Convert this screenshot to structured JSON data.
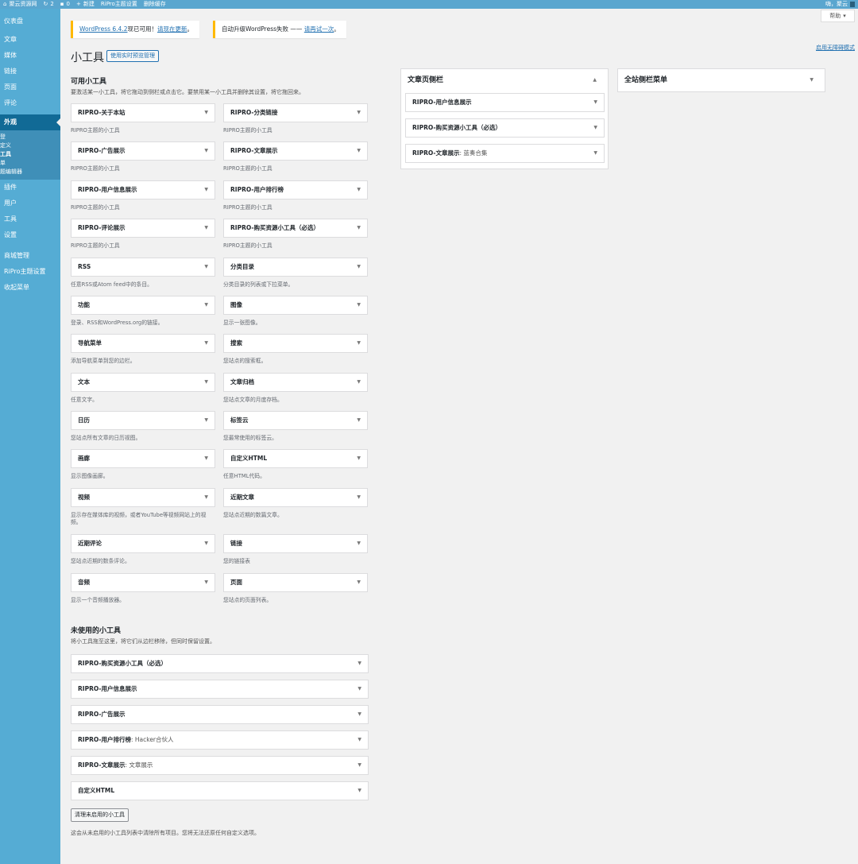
{
  "adminbar": {
    "site_name": "聚云资源网",
    "updates_count": "2",
    "comments_count": "0",
    "new_label": "新建",
    "theme_settings": "RiPro主题设置",
    "clear_cache": "删除缓存",
    "greeting": "嗨，聚云"
  },
  "sidebar": {
    "items": [
      {
        "label": "仪表盘"
      },
      {
        "label": "文章"
      },
      {
        "label": "媒体"
      },
      {
        "label": "链接"
      },
      {
        "label": "页面"
      },
      {
        "label": "评论"
      }
    ],
    "current": "外观",
    "submenu": [
      "登",
      "定义",
      "工具",
      "单",
      "题编辑器"
    ],
    "items2": [
      {
        "label": "插件"
      },
      {
        "label": "用户"
      },
      {
        "label": "工具"
      },
      {
        "label": "设置"
      }
    ],
    "items3": [
      {
        "label": "商城管理"
      },
      {
        "label": "RiPro主题设置"
      },
      {
        "label": "收起菜单"
      }
    ]
  },
  "help": {
    "label": "帮助"
  },
  "accessibility_link": "启用无障碍模式",
  "notices": {
    "n1_link": "WordPress 6.4.2",
    "n1_text": "现已可用！",
    "n1_link2": "请现在更新",
    "n1_end": "。",
    "n2_text": "自动升级WordPress失败 —— ",
    "n2_link": "请再试一次",
    "n2_end": "。"
  },
  "page": {
    "title": "小工具",
    "live_preview": "使用实时预览管理",
    "available_title": "可用小工具",
    "available_desc": "要激活某一小工具，将它拖动到侧栏或点击它。要禁用某一小工具并删除其设置，将它拖回来。",
    "inactive_title": "未使用的小工具",
    "inactive_desc": "将小工具拖至这里，将它们从边栏移除，但同时保留设置。",
    "clear_button": "清理未启用的小工具",
    "clear_desc": "这会从未启用的小工具列表中清除所有项目。您将无法还原任何自定义选项。"
  },
  "widgets": {
    "w1": {
      "title": "RIPRO-关于本站",
      "desc": "RIPRO主题的小工具"
    },
    "w2": {
      "title": "RIPRO-分类链接",
      "desc": "RIPRO主题的小工具"
    },
    "w3": {
      "title": "RIPRO-广告展示",
      "desc": "RIPRO主题的小工具"
    },
    "w4": {
      "title": "RIPRO-文章展示",
      "desc": "RIPRO主题的小工具"
    },
    "w5": {
      "title": "RIPRO-用户信息展示",
      "desc": "RIPRO主题的小工具"
    },
    "w6": {
      "title": "RIPRO-用户排行榜",
      "desc": "RIPRO主题的小工具"
    },
    "w7": {
      "title": "RIPRO-评论展示",
      "desc": "RIPRO主题的小工具"
    },
    "w8": {
      "title": "RIPRO-购买资源小工具（必选）",
      "desc": "RIPRO主题的小工具"
    },
    "w9": {
      "title": "RSS",
      "desc": "任意RSS或Atom feed中的条目。"
    },
    "w10": {
      "title": "分类目录",
      "desc": "分类目录的列表或下拉菜单。"
    },
    "w11": {
      "title": "功能",
      "desc": "登录、RSS和WordPress.org的链接。"
    },
    "w12": {
      "title": "图像",
      "desc": "显示一张图像。"
    },
    "w13": {
      "title": "导航菜单",
      "desc": "添加导航菜单到您的边栏。"
    },
    "w14": {
      "title": "搜索",
      "desc": "您站点的搜索框。"
    },
    "w15": {
      "title": "文本",
      "desc": "任意文字。"
    },
    "w16": {
      "title": "文章归档",
      "desc": "您站点文章的月度存档。"
    },
    "w17": {
      "title": "日历",
      "desc": "您站点所有文章的日历视图。"
    },
    "w18": {
      "title": "标签云",
      "desc": "您最常使用的标签云。"
    },
    "w19": {
      "title": "画廊",
      "desc": "显示图像画廊。"
    },
    "w20": {
      "title": "自定义HTML",
      "desc": "任意HTML代码。"
    },
    "w21": {
      "title": "视频",
      "desc": "显示存在媒体库的视频，或者YouTube等视频网站上的视频。"
    },
    "w22": {
      "title": "近期文章",
      "desc": "您站点近期的数篇文章。"
    },
    "w23": {
      "title": "近期评论",
      "desc": "您站点近期的数条评论。"
    },
    "w24": {
      "title": "链接",
      "desc": "您的链接表"
    },
    "w25": {
      "title": "音频",
      "desc": "显示一个音频播放器。"
    },
    "w26": {
      "title": "页面",
      "desc": "您站点的页面列表。"
    }
  },
  "article_sidebar": {
    "title": "文章页侧栏",
    "items": [
      {
        "title": "RIPRO-用户信息展示",
        "sub": ""
      },
      {
        "title": "RIPRO-购买资源小工具（必选）",
        "sub": ""
      },
      {
        "title": "RIPRO-文章展示",
        "sub": ": 蓝奏合集"
      }
    ]
  },
  "global_sidebar": {
    "title": "全站侧栏菜单"
  },
  "inactive": [
    {
      "title": "RIPRO-购买资源小工具（必选）",
      "sub": ""
    },
    {
      "title": "RIPRO-用户信息展示",
      "sub": ""
    },
    {
      "title": "RIPRO-广告展示",
      "sub": ""
    },
    {
      "title": "RIPRO-用户排行榜",
      "sub": ": Hacker合伙人"
    },
    {
      "title": "RIPRO-文章展示",
      "sub": ": 文章展示"
    },
    {
      "title": "自定义HTML",
      "sub": ""
    }
  ],
  "colors": {
    "adminbar": "#5aa6cf",
    "sidebar": "#55acd4",
    "current": "#116a96",
    "notice": "#ffb900",
    "link": "#2271b1"
  }
}
